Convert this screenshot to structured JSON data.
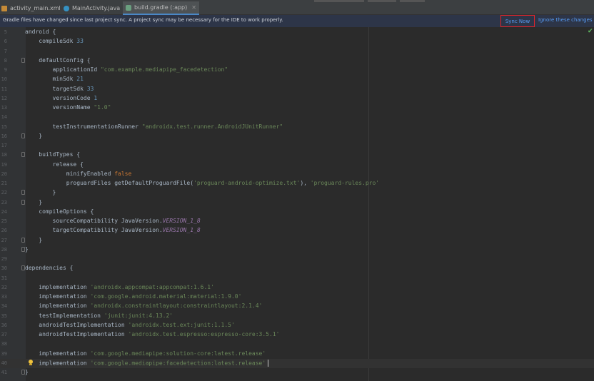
{
  "tabs": [
    {
      "label": "activity_main.xml",
      "icon": "xml-file-icon",
      "active": false
    },
    {
      "label": "MainActivity.java",
      "icon": "java-class-icon",
      "active": false
    },
    {
      "label": "build.gradle (:app)",
      "icon": "gradle-file-icon",
      "active": true
    }
  ],
  "banner": {
    "message": "Gradle files have changed since last project sync. A project sync may be necessary for the IDE to work properly.",
    "sync_now": "Sync Now",
    "ignore": "Ignore these changes"
  },
  "colors": {
    "keyword_orange": "#cc7832",
    "number_blue": "#6897bb",
    "string_green": "#6a8759",
    "constant_purple": "#9876aa",
    "link_blue": "#589df6",
    "highlight_red": "#e0242a"
  },
  "editor": {
    "lines": [
      {
        "n": "5",
        "t": "android {"
      },
      {
        "n": "6",
        "t": "    compileSdk 33"
      },
      {
        "n": "7",
        "t": ""
      },
      {
        "n": "8",
        "t": "    defaultConfig {"
      },
      {
        "n": "9",
        "t": "        applicationId \"com.example.mediapipe_facedetection\""
      },
      {
        "n": "10",
        "t": "        minSdk 21"
      },
      {
        "n": "11",
        "t": "        targetSdk 33"
      },
      {
        "n": "12",
        "t": "        versionCode 1"
      },
      {
        "n": "13",
        "t": "        versionName \"1.0\""
      },
      {
        "n": "14",
        "t": ""
      },
      {
        "n": "15",
        "t": "        testInstrumentationRunner \"androidx.test.runner.AndroidJUnitRunner\""
      },
      {
        "n": "16",
        "t": "    }"
      },
      {
        "n": "17",
        "t": ""
      },
      {
        "n": "18",
        "t": "    buildTypes {"
      },
      {
        "n": "19",
        "t": "        release {"
      },
      {
        "n": "20",
        "t": "            minifyEnabled false"
      },
      {
        "n": "21",
        "t": "            proguardFiles getDefaultProguardFile('proguard-android-optimize.txt'), 'proguard-rules.pro'"
      },
      {
        "n": "22",
        "t": "        }"
      },
      {
        "n": "23",
        "t": "    }"
      },
      {
        "n": "24",
        "t": "    compileOptions {"
      },
      {
        "n": "25",
        "t": "        sourceCompatibility JavaVersion.VERSION_1_8"
      },
      {
        "n": "26",
        "t": "        targetCompatibility JavaVersion.VERSION_1_8"
      },
      {
        "n": "27",
        "t": "    }"
      },
      {
        "n": "28",
        "t": "}"
      },
      {
        "n": "29",
        "t": ""
      },
      {
        "n": "30",
        "t": "dependencies {"
      },
      {
        "n": "31",
        "t": ""
      },
      {
        "n": "32",
        "t": "    implementation 'androidx.appcompat:appcompat:1.6.1'"
      },
      {
        "n": "33",
        "t": "    implementation 'com.google.android.material:material:1.9.0'"
      },
      {
        "n": "34",
        "t": "    implementation 'androidx.constraintlayout:constraintlayout:2.1.4'"
      },
      {
        "n": "35",
        "t": "    testImplementation 'junit:junit:4.13.2'"
      },
      {
        "n": "36",
        "t": "    androidTestImplementation 'androidx.test.ext:junit:1.1.5'"
      },
      {
        "n": "37",
        "t": "    androidTestImplementation 'androidx.test.espresso:espresso-core:3.5.1'"
      },
      {
        "n": "38",
        "t": ""
      },
      {
        "n": "39",
        "t": "    implementation 'com.google.mediapipe:solution-core:latest.release'"
      },
      {
        "n": "40",
        "t": "    implementation 'com.google.mediapipe:facedetection:latest.release'"
      },
      {
        "n": "41",
        "t": "}"
      }
    ]
  }
}
